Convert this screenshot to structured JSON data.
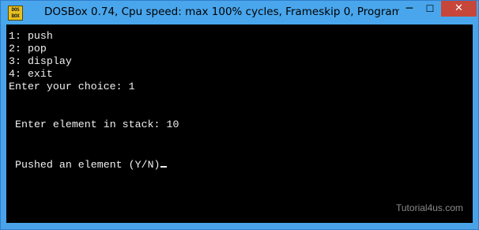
{
  "window": {
    "title": "DOSBox 0.74, Cpu speed: max 100% cycles, Frameskip  0, Program:",
    "icon_name": "dosbox-icon",
    "icon_text": "DOS BOX"
  },
  "controls": {
    "minimize": "─",
    "maximize": "☐",
    "close": "✕"
  },
  "console": {
    "lines": [
      "1: push",
      "2: pop",
      "3: display",
      "4: exit",
      "Enter your choice: 1",
      "Enter element in stack: 10",
      "Pushed an element (Y/N)"
    ],
    "colors": {
      "background": "#000000",
      "text": "#f0f0f0"
    }
  },
  "watermark": "Tutorial4us.com",
  "colors": {
    "titlebar": "#49a6ec",
    "close_button": "#c7463a"
  }
}
